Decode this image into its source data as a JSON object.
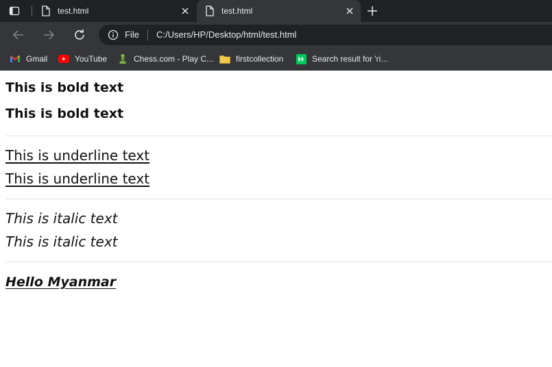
{
  "tabs": [
    {
      "title": "test.html",
      "active": false
    },
    {
      "title": "test.html",
      "active": true
    }
  ],
  "address": {
    "scheme_label": "File",
    "url": "C:/Users/HP/Desktop/html/test.html"
  },
  "bookmarks": [
    {
      "label": "Gmail",
      "icon": "gmail-icon"
    },
    {
      "label": "YouTube",
      "icon": "youtube-icon"
    },
    {
      "label": "Chess.com - Play C...",
      "icon": "chess-icon"
    },
    {
      "label": "firstcollection",
      "icon": "folder-icon"
    },
    {
      "label": "Search result for 'ri...",
      "icon": "search-result-icon"
    }
  ],
  "page": {
    "bold": [
      "This is bold text",
      "This is bold text"
    ],
    "underline": [
      "This is underline text",
      "This is underline text"
    ],
    "italic": [
      "This is italic text",
      "This is italic text"
    ],
    "combo": "Hello Myanmar"
  },
  "colors": {
    "chrome_dark": "#202124",
    "chrome_toolbar": "#35363a",
    "youtube_red": "#ff0000",
    "folder_yellow": "#f2c94c"
  }
}
